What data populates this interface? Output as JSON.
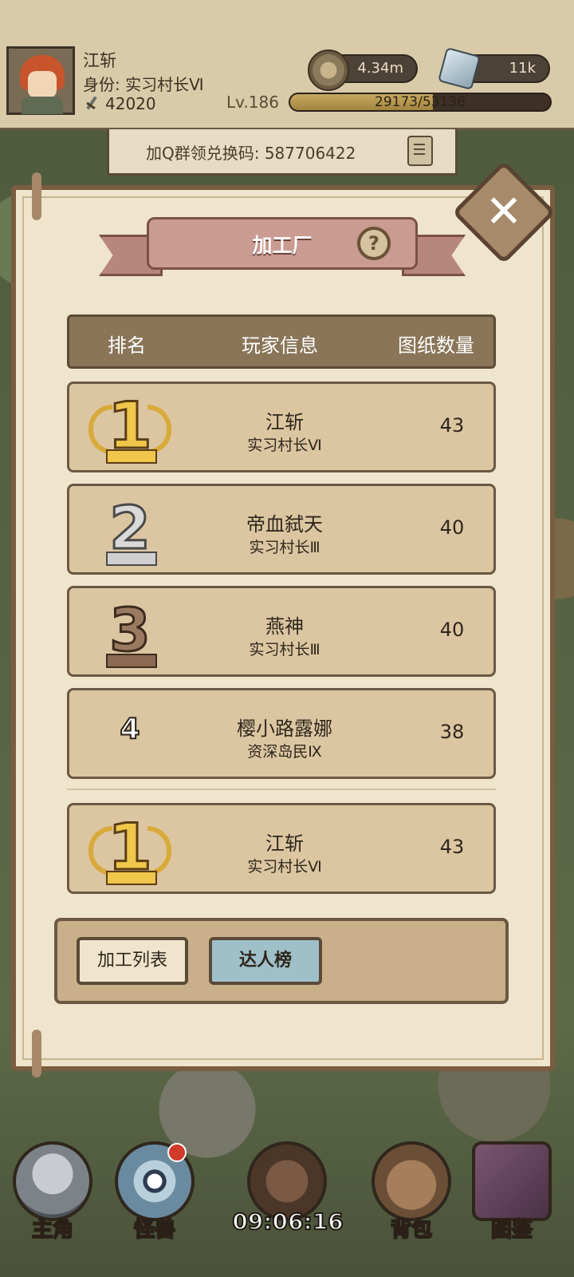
{
  "player": {
    "name": "江斩",
    "title": "身份: 实习村长Ⅵ",
    "power": "42020",
    "level": "Lv.186",
    "xp_text": "29173/53136",
    "xp_progress": 0.549
  },
  "currencies": {
    "coins": "4.34m",
    "gems": "11k"
  },
  "redeem_code_text": "加Q群领兑换码: 587706422",
  "panel": {
    "title": "加工厂",
    "headers": {
      "rank": "排名",
      "player_info": "玩家信息",
      "blueprint_count": "图纸数量"
    },
    "rows": [
      {
        "rank": "1",
        "name": "江斩",
        "title": "实习村长Ⅵ",
        "count": "43"
      },
      {
        "rank": "2",
        "name": "帝血弑天",
        "title": "实习村长Ⅲ",
        "count": "40"
      },
      {
        "rank": "3",
        "name": "燕神",
        "title": "实习村长Ⅲ",
        "count": "40"
      },
      {
        "rank": "4",
        "name": "樱小路露娜",
        "title": "资深岛民Ⅸ",
        "count": "38"
      }
    ],
    "my_row": {
      "rank": "1",
      "name": "江斩",
      "title": "实习村长Ⅵ",
      "count": "43"
    },
    "tabs": {
      "list": "加工列表",
      "leaderboard": "达人榜"
    }
  },
  "nav": {
    "hero": "主角",
    "monster": "怪兽",
    "bag": "背包",
    "codex": "图鉴"
  },
  "clock": "09:06:16",
  "colors": {
    "panel_bg": "#efe5cc",
    "header_bar": "#8a7558",
    "ribbon": "#c99b91",
    "active_tab": "#9fc0c9"
  }
}
